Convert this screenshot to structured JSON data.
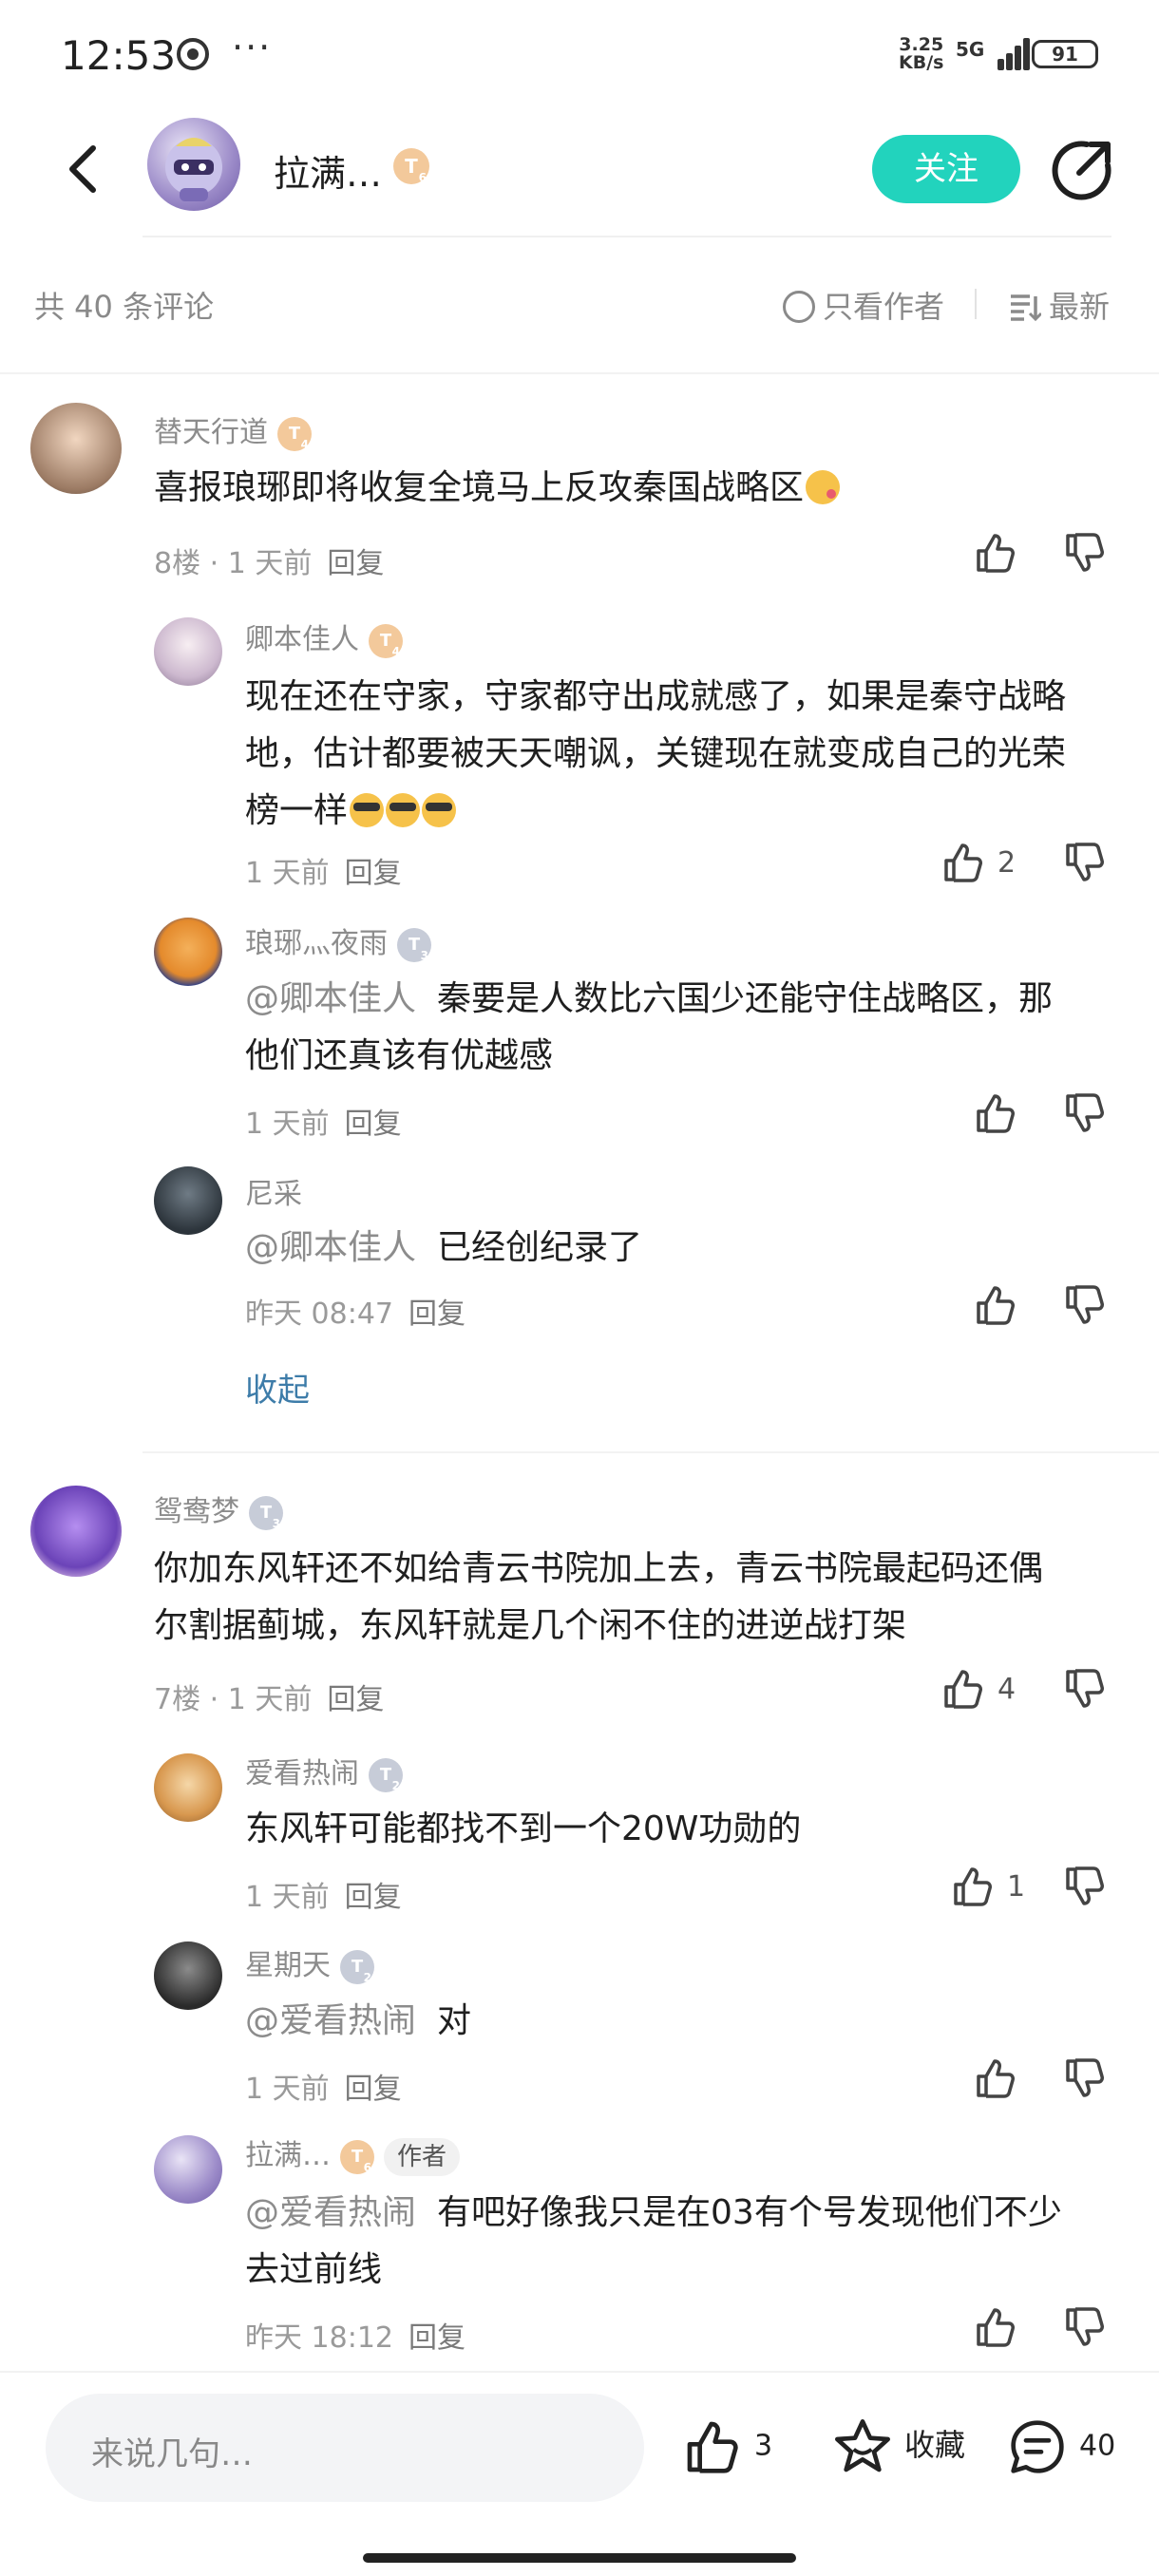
{
  "status_bar": {
    "time": "12:53",
    "more": "···",
    "speed_top": "3.25",
    "speed_bottom": "KB/s",
    "network": "5G",
    "battery": "91"
  },
  "header": {
    "name": "拉满…",
    "level": "T",
    "level_sub": "6",
    "follow_label": "关注"
  },
  "toolbar": {
    "count_label": "共 40 条评论",
    "only_author_label": "只看作者",
    "sort_label": "最新"
  },
  "comments": [
    {
      "user": "替天行道",
      "level": "T",
      "level_sub": "4",
      "level_color": "#f3c99b",
      "text": "喜报琅琊即将收复全境马上反攻秦国战略区",
      "floor": "8楼",
      "time": "1 天前",
      "reply_label": "回复",
      "likes": "",
      "replies": [
        {
          "user": "卿本佳人",
          "level": "T",
          "level_sub": "4",
          "level_color": "#f3c99b",
          "text_lines": [
            "现在还在守家，守家都守出成就感了，如果是秦守战略",
            "地，估计都要被天天嘲讽，关键现在就变成自己的光荣",
            "榜一样"
          ],
          "time": "1 天前",
          "reply_label": "回复",
          "likes": "2"
        },
        {
          "user": "琅琊灬夜雨",
          "level": "T",
          "level_sub": "3",
          "level_color": "#c7ccd8",
          "mention": "@卿本佳人",
          "text_lines": [
            "秦要是人数比六国少还能守住战略区，那",
            "他们还真该有优越感"
          ],
          "time": "1 天前",
          "reply_label": "回复",
          "likes": ""
        },
        {
          "user": "尼采",
          "mention": "@卿本佳人",
          "text_lines": [
            "已经创纪录了"
          ],
          "time": "昨天 08:47",
          "reply_label": "回复",
          "likes": ""
        }
      ],
      "collapse_label": "收起"
    },
    {
      "user": "鸳鸯梦",
      "level": "T",
      "level_sub": "3",
      "level_color": "#c7ccd8",
      "text_lines": [
        "你加东风轩还不如给青云书院加上去，青云书院最起码还偶",
        "尔割据蓟城，东风轩就是几个闲不住的进逆战打架"
      ],
      "floor": "7楼",
      "time": "1 天前",
      "reply_label": "回复",
      "likes": "4",
      "replies": [
        {
          "user": "爱看热闹",
          "level": "T",
          "level_sub": "2",
          "level_color": "#c7ccd8",
          "text_lines": [
            "东风轩可能都找不到一个20W功勋的"
          ],
          "time": "1 天前",
          "reply_label": "回复",
          "likes": "1"
        },
        {
          "user": "星期天",
          "level": "T",
          "level_sub": "2",
          "level_color": "#c7ccd8",
          "mention": "@爱看热闹",
          "text_lines": [
            "对"
          ],
          "time": "1 天前",
          "reply_label": "回复",
          "likes": ""
        },
        {
          "user": "拉满…",
          "level": "T",
          "level_sub": "6",
          "level_color": "#f3c99b",
          "tag": "作者",
          "mention": "@爱看热闹",
          "text_lines": [
            "有吧好像我只是在03有个号发现他们不少",
            "去过前线"
          ],
          "time": "昨天 18:12",
          "reply_label": "回复",
          "likes": ""
        }
      ]
    }
  ],
  "bottom_bar": {
    "input_placeholder": "来说几句…",
    "like_count": "3",
    "favorite_label": "收藏",
    "comment_count": "40"
  },
  "icons": [
    "back-icon",
    "share-icon",
    "radio-icon",
    "sort-icon",
    "thumb-up-icon",
    "thumb-down-icon",
    "star-icon",
    "comment-icon"
  ],
  "colors": {
    "accent": "#22d3bd",
    "link": "#3d7ca9",
    "meta": "#9a9a9a",
    "gold_badge": "#f3c99b",
    "silver_badge": "#c7ccd8"
  }
}
